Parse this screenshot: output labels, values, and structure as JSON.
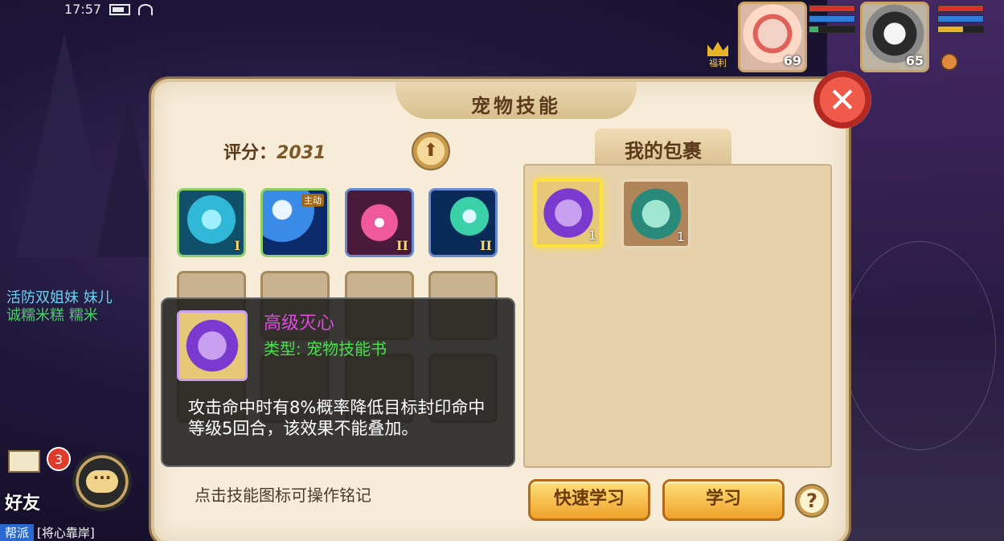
{
  "status_bar": {
    "time": "17:57"
  },
  "party": [
    {
      "level": "69"
    },
    {
      "level": "65"
    }
  ],
  "welfare_label": "福利",
  "chat": {
    "line1": "活防双姐妹 妹儿",
    "line2": "诚糯米糕 糯米"
  },
  "friends": {
    "badge_count": "3",
    "label": "好友"
  },
  "guild": {
    "tag": "帮派",
    "message": "[将心靠岸]"
  },
  "panel": {
    "title": "宠物技能",
    "score_label": "评分：",
    "score_value": "2031",
    "skills": [
      {
        "icon": "ghost-skill-icon",
        "tier": "I"
      },
      {
        "icon": "burst-skill-icon",
        "tag": "主动"
      },
      {
        "icon": "star-skill-icon",
        "tier": "II"
      },
      {
        "icon": "swirl-skill-icon",
        "tier": "II"
      }
    ],
    "bag_title": "我的包裹",
    "bag_items": [
      {
        "icon": "purple-skill-book-icon",
        "qty": "1"
      },
      {
        "icon": "green-skill-book-icon",
        "qty": "1"
      }
    ],
    "tooltip": {
      "name": "高级灭心",
      "type": "类型: 宠物技能书",
      "description": "攻击命中时有8%概率降低目标封印命中等级5回合，该效果不能叠加。"
    },
    "hint": "点击技能图标可操作铭记",
    "buttons": {
      "fast_learn": "快速学习",
      "learn": "学习",
      "help": "?"
    }
  }
}
